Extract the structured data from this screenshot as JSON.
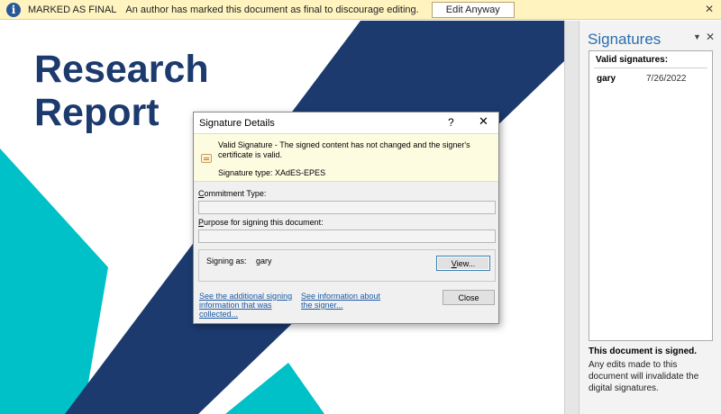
{
  "message_bar": {
    "title": "MARKED AS FINAL",
    "text": "An author has marked this document as final to discourage editing.",
    "button": "Edit Anyway",
    "info_icon": "i",
    "close_icon": "✕",
    "colors": {
      "background": "#fff4c0",
      "icon": "#2b5797"
    }
  },
  "document": {
    "title": "Research\nReport",
    "colors": {
      "title": "#1c3a6e",
      "navy": "#1c3a6e",
      "teal": "#00c0c8"
    }
  },
  "signatures_pane": {
    "title": "Signatures",
    "menu_icon": "▼",
    "close_icon": "✕",
    "list_header": "Valid signatures:",
    "signatures": [
      {
        "name": "gary",
        "date": "7/26/2022"
      }
    ],
    "status": "This document is signed.",
    "note": "Any edits made to this document will invalidate the digital signatures."
  },
  "dialog": {
    "title": "Signature Details",
    "help": "?",
    "close": "✕",
    "valid_message": "Valid Signature - The signed content has not changed and the signer's certificate is valid.",
    "signature_type": "Signature type: XAdES-EPES",
    "commitment_label_key": "C",
    "commitment_label_rest": "ommitment Type:",
    "commitment_value": "",
    "purpose_label_key": "P",
    "purpose_label_rest": "urpose for signing this document:",
    "purpose_value": "",
    "signing_as_label": "Signing as:",
    "signing_as_value": "gary",
    "view_key": "V",
    "view_rest": "iew...",
    "link_additional": "See the additional signing information that was collected...",
    "link_signer": "See information about the signer...",
    "close_button": "Close"
  }
}
